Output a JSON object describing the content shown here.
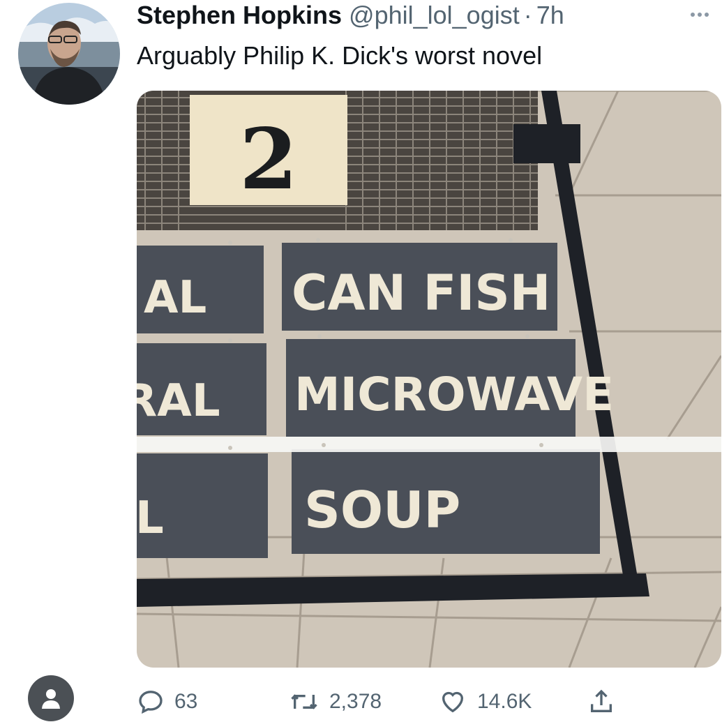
{
  "tweet": {
    "author_name": "Stephen Hopkins",
    "handle": "@phil_lol_ogist",
    "separator": "·",
    "time": "7h",
    "text": "Arguably Philip K. Dick's worst novel"
  },
  "image": {
    "aisle_number": "2",
    "signs_left": [
      "AL",
      "RAL",
      "L"
    ],
    "signs_right": [
      "CAN FISH",
      "MICROWAVE",
      "SOUP"
    ]
  },
  "actions": {
    "reply_count": "63",
    "retweet_count": "2,378",
    "like_count": "14.6K"
  },
  "icons": {
    "more": "more-horizontal-icon",
    "reply": "reply-icon",
    "retweet": "retweet-icon",
    "like": "heart-icon",
    "share": "share-icon",
    "user": "user-icon"
  }
}
